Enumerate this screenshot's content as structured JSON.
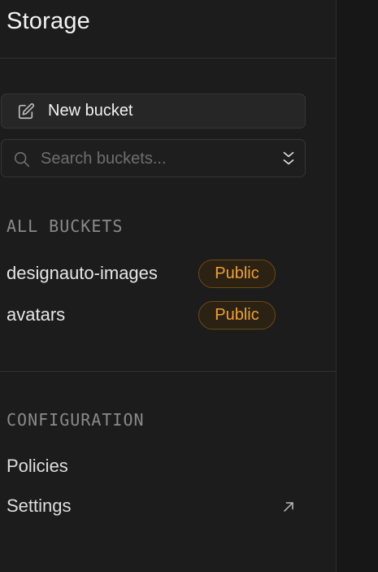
{
  "header": {
    "title": "Storage"
  },
  "actions": {
    "new_bucket_label": "New bucket",
    "new_bucket_icon": "edit-icon"
  },
  "search": {
    "placeholder": "Search buckets...",
    "value": "",
    "icon": "search-icon",
    "sort_icon": "chevrons-down-icon"
  },
  "buckets": {
    "section_label": "ALL BUCKETS",
    "items": [
      {
        "name": "designauto-images",
        "badge": "Public"
      },
      {
        "name": "avatars",
        "badge": "Public"
      }
    ]
  },
  "configuration": {
    "section_label": "CONFIGURATION",
    "items": [
      {
        "label": "Policies"
      },
      {
        "label": "Settings",
        "icon": "external-link-icon"
      }
    ]
  },
  "colors": {
    "background": "#1c1c1c",
    "badge_text": "#f0a030",
    "badge_border": "#6b4a12",
    "badge_bg": "#2b2213",
    "section_label": "#8a8a8a"
  }
}
